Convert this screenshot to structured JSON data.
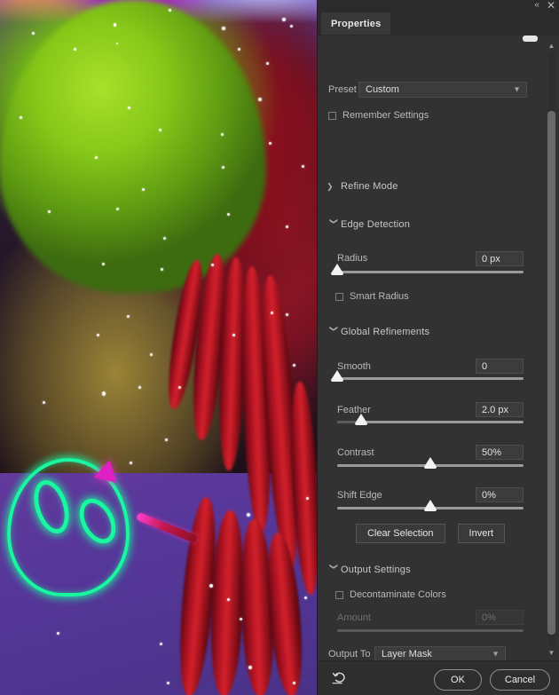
{
  "window": {
    "collapse_icon": "chevron-double-left-icon",
    "close_icon": "close-icon"
  },
  "panel": {
    "tab_label": "Properties",
    "scroll_up_icon": "chevron-up-icon",
    "scroll_down_icon": "chevron-down-icon"
  },
  "preset": {
    "label": "Preset",
    "value": "Custom",
    "chevron": "chevron-down-icon",
    "options": [
      "Custom"
    ]
  },
  "remember": {
    "label": "Remember Settings",
    "checked": false
  },
  "sections": {
    "refine_mode": {
      "label": "Refine Mode",
      "expanded": false,
      "arrow": "chevron-right-icon"
    },
    "edge_detection": {
      "label": "Edge Detection",
      "expanded": true,
      "arrow": "chevron-down-icon"
    },
    "global_refinements": {
      "label": "Global Refinements",
      "expanded": true,
      "arrow": "chevron-down-icon"
    },
    "output_settings": {
      "label": "Output Settings",
      "expanded": true,
      "arrow": "chevron-down-icon"
    }
  },
  "sliders": {
    "radius": {
      "label": "Radius",
      "value": "0 px",
      "percent": 0
    },
    "smooth": {
      "label": "Smooth",
      "value": "0",
      "percent": 0
    },
    "feather": {
      "label": "Feather",
      "value": "2.0 px",
      "percent": 13
    },
    "contrast": {
      "label": "Contrast",
      "value": "50%",
      "percent": 50
    },
    "shift_edge": {
      "label": "Shift Edge",
      "value": "0%",
      "percent": 50
    },
    "amount": {
      "label": "Amount",
      "value": "0%",
      "percent": 0,
      "disabled": true
    }
  },
  "smart_radius": {
    "label": "Smart Radius",
    "checked": false
  },
  "decontaminate": {
    "label": "Decontaminate Colors",
    "checked": false
  },
  "buttons": {
    "clear_selection": "Clear Selection",
    "invert": "Invert",
    "ok": "OK",
    "cancel": "Cancel",
    "reset_icon": "reset-undo-icon"
  },
  "output_to": {
    "label": "Output To",
    "value": "Layer Mask",
    "chevron": "chevron-down-icon",
    "options": [
      "Layer Mask"
    ]
  },
  "colors": {
    "panel_bg": "#323232",
    "tab_bg": "#383838",
    "track": "#9b9b9b",
    "knob": "#f2f2f2",
    "text": "#d4d4d4"
  }
}
